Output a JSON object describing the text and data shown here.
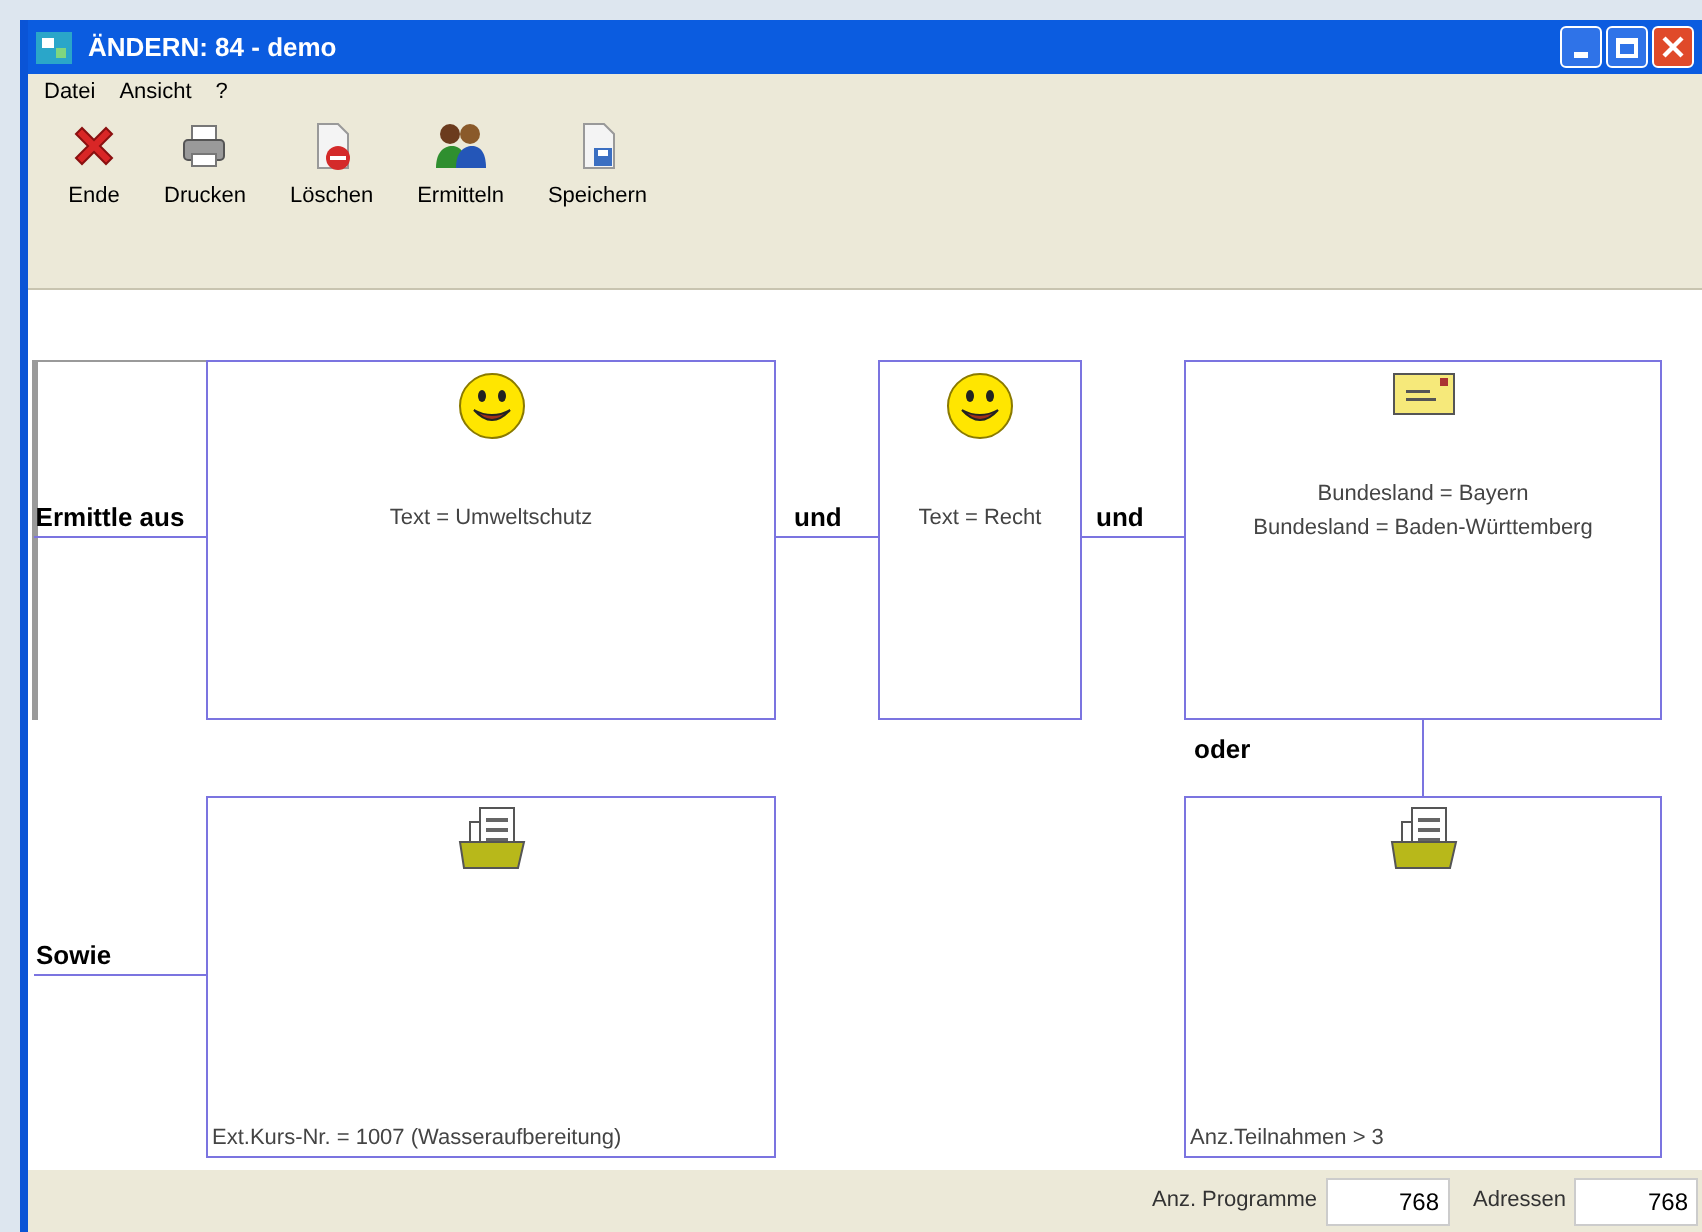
{
  "window": {
    "title": "ÄNDERN: 84 - demo"
  },
  "menu": [
    "Datei",
    "Ansicht",
    "?"
  ],
  "toolbar": [
    {
      "kind": "close",
      "label": "Ende"
    },
    {
      "kind": "print",
      "label": "Drucken"
    },
    {
      "kind": "delete",
      "label": "Löschen"
    },
    {
      "kind": "people",
      "label": "Ermitteln"
    },
    {
      "kind": "save",
      "label": "Speichern"
    }
  ],
  "diagram": {
    "nodes": [
      {
        "kind": "smiley",
        "lines": [
          "Text = Umweltschutz"
        ]
      },
      {
        "kind": "smiley",
        "lines": [
          "Text = Recht"
        ]
      },
      {
        "kind": "envelope",
        "lines": [
          "Bundesland = Bayern",
          "Bundesland = Baden-Württemberg"
        ]
      },
      {
        "kind": "folder",
        "lines": [
          "Ext.Kurs-Nr. = 1007 (Wasseraufbereitung)"
        ]
      },
      {
        "kind": "folder",
        "lines": [
          "Anz.Teilnahmen > 3"
        ]
      }
    ],
    "connectors": [
      {
        "label": "Ermittle aus"
      },
      {
        "label": "und"
      },
      {
        "label": "und"
      },
      {
        "label": "oder"
      },
      {
        "label": "Sowie"
      }
    ]
  },
  "status_bar": [
    {
      "label": "Anz. Programme",
      "value": "768"
    },
    {
      "label": "Adressen",
      "value": "768"
    }
  ]
}
